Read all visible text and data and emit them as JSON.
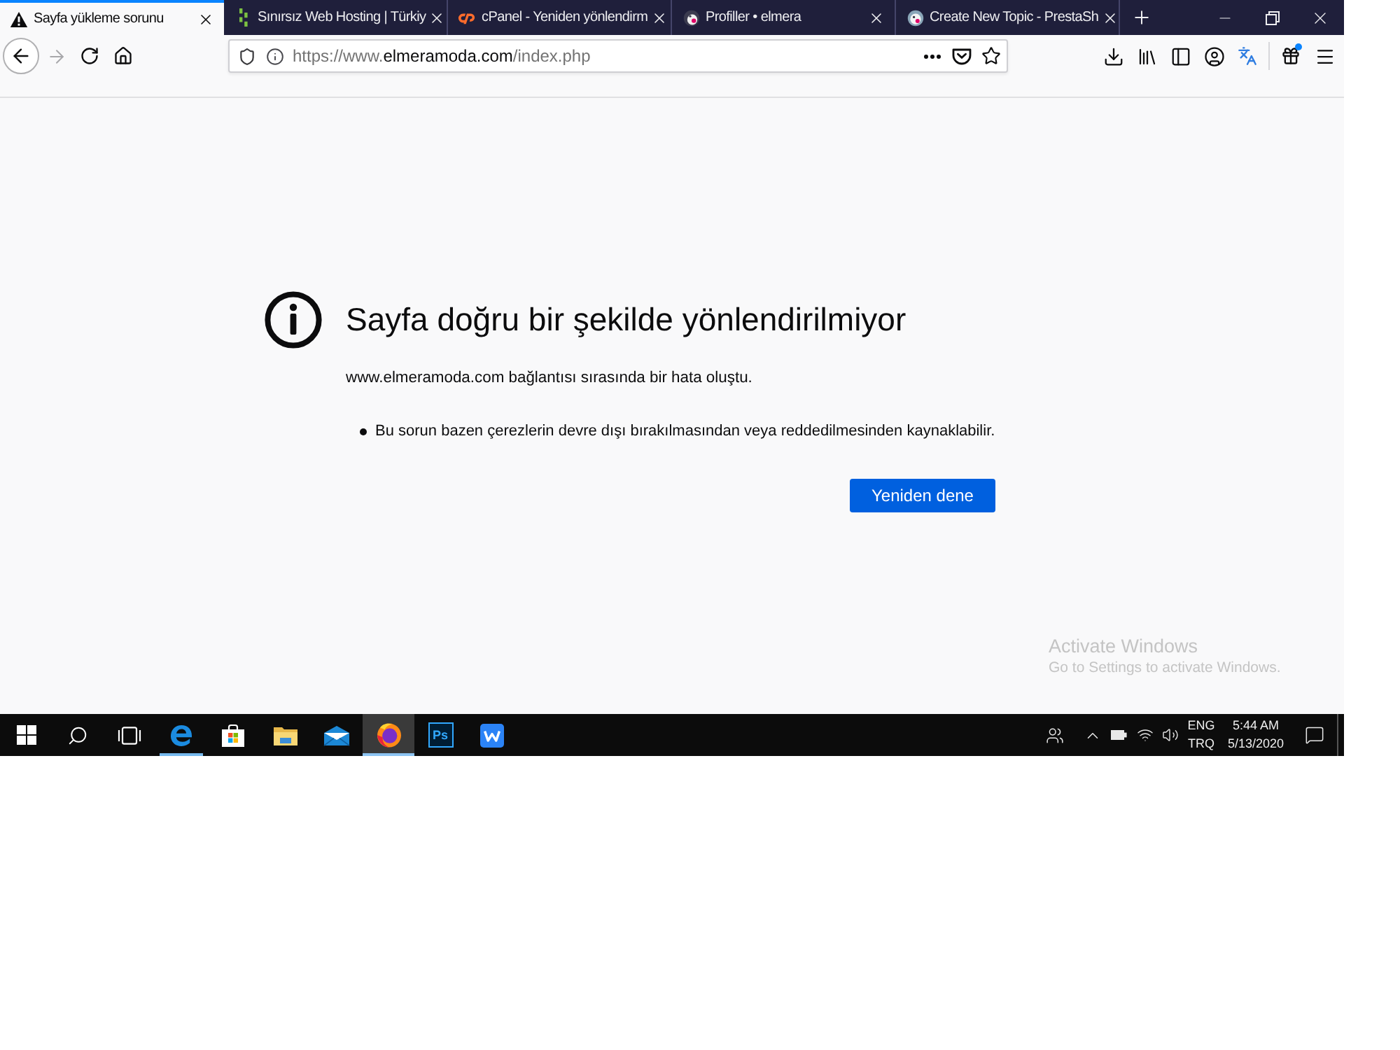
{
  "browser": {
    "tabs": [
      {
        "kind": "warning",
        "title": "Sayfa yükleme sorunu",
        "selected": true
      },
      {
        "kind": "hosting",
        "title": "Sınırsız Web Hosting | Türkiy",
        "selected": false
      },
      {
        "kind": "cpanel",
        "title": "cPanel - Yeniden yönlendirm",
        "selected": false
      },
      {
        "kind": "prestashop",
        "title": "Profiller • elmera",
        "selected": false
      },
      {
        "kind": "forum",
        "title": "Create New Topic - PrestaSh",
        "selected": false
      }
    ],
    "address_bar": {
      "url_prefix": "https://www.",
      "url_domain": "elmeramoda.com",
      "url_path": "/index.php"
    }
  },
  "error_page": {
    "title": "Sayfa doğru bir şekilde yönlendirilmiyor",
    "message": "www.elmeramoda.com bağlantısı sırasında bir hata oluştu.",
    "bullets": [
      "Bu sorun bazen çerezlerin devre dışı bırakılmasından veya reddedilmesinden kaynaklabilir."
    ],
    "button": "Yeniden dene"
  },
  "activation_notice": {
    "title": "Activate Windows",
    "subtitle": "Go to Settings to activate Windows."
  },
  "taskbar": {
    "buttons": [
      {
        "kind": "start",
        "running": false,
        "selected": false
      },
      {
        "kind": "search",
        "running": false,
        "selected": false
      },
      {
        "kind": "task-view",
        "running": false,
        "selected": false
      },
      {
        "kind": "edge",
        "running": true,
        "selected": false
      },
      {
        "kind": "store",
        "running": false,
        "selected": false
      },
      {
        "kind": "files",
        "running": false,
        "selected": false
      },
      {
        "kind": "mail",
        "running": false,
        "selected": false
      },
      {
        "kind": "firefox",
        "running": true,
        "selected": true
      },
      {
        "kind": "photoshop",
        "label": "Ps",
        "running": false,
        "selected": false
      },
      {
        "kind": "wps",
        "running": false,
        "selected": false
      }
    ],
    "language": {
      "input": "ENG",
      "layout": "TRQ"
    },
    "clock": {
      "time": "5:44 AM",
      "date": "5/13/2020"
    }
  }
}
